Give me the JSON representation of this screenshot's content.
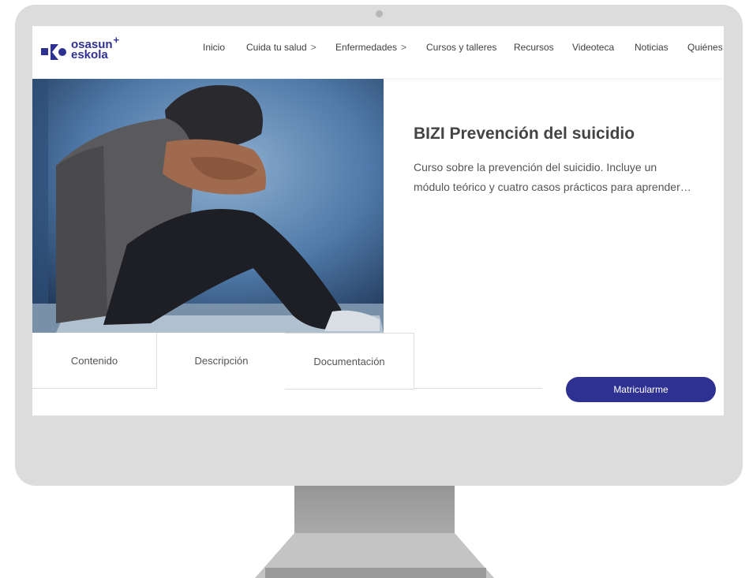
{
  "logo": {
    "line1": "osasun",
    "plus": "+",
    "line2": "eskola"
  },
  "nav": {
    "items": [
      {
        "label": "Inicio",
        "chevron": ""
      },
      {
        "label": "Cuida tu salud",
        "chevron": ">"
      },
      {
        "label": "Enfermedades",
        "chevron": ">"
      },
      {
        "label": "Cursos y talleres",
        "chevron": ""
      },
      {
        "label": "Recursos",
        "chevron": ""
      },
      {
        "label": "Videoteca",
        "chevron": ""
      },
      {
        "label": "Noticias",
        "chevron": ""
      },
      {
        "label": "Quiénes",
        "chevron": ""
      }
    ]
  },
  "course": {
    "title": "BIZI Prevención del suicidio",
    "description_line1": "Curso sobre la prevención del suicidio. Incluye un",
    "description_line2": "módulo teórico y cuatro casos prácticos para aprender…"
  },
  "tabs": [
    {
      "label": "Contenido"
    },
    {
      "label": "Descripción"
    },
    {
      "label": "Documentación"
    }
  ],
  "enroll_button": {
    "label": "Matricularme"
  },
  "colors": {
    "brand": "#2f3192",
    "monitor": "#dcdcdc",
    "stand": "#a9a9a9"
  }
}
